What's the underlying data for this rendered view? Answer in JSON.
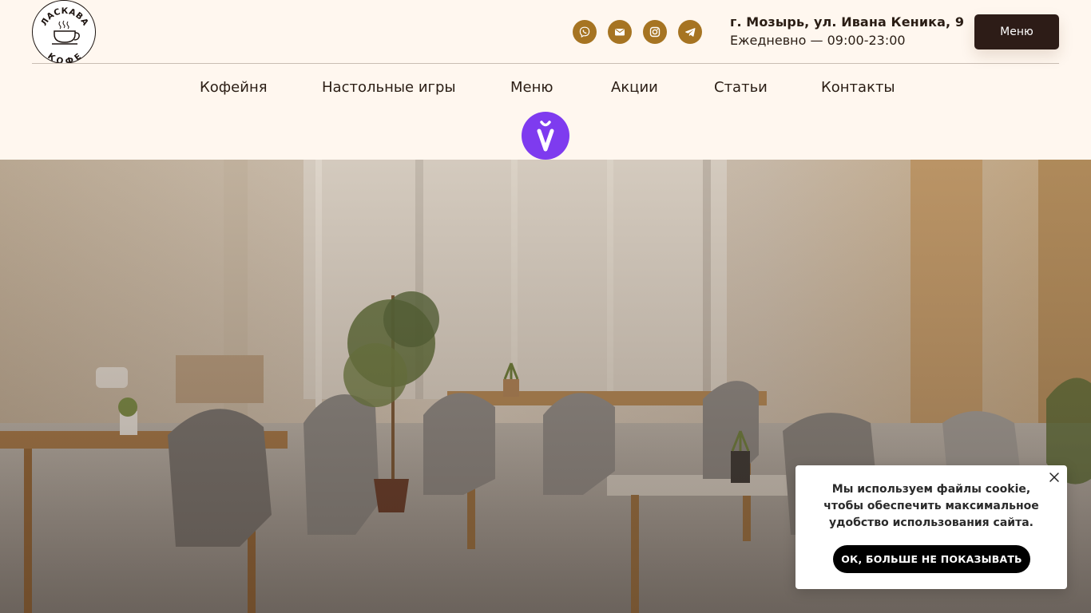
{
  "header": {
    "logo": {
      "icon": "coffee-cup-logo",
      "text_top": "ЛАСКАВА",
      "text_bottom": "КОФЕ"
    },
    "socials": [
      {
        "icon": "phone-viber-icon"
      },
      {
        "icon": "mail-icon"
      },
      {
        "icon": "instagram-icon"
      },
      {
        "icon": "telegram-icon"
      }
    ],
    "address": "г. Мозырь, ул. Ивана Кеника, 9",
    "hours": "Ежедневно — 09:00-23:00",
    "menu_button_label": "Меню"
  },
  "nav": {
    "items": [
      {
        "label": "Кофейня"
      },
      {
        "label": "Настольные игры"
      },
      {
        "label": "Меню"
      },
      {
        "label": "Акции"
      },
      {
        "label": "Статьи"
      },
      {
        "label": "Контакты"
      }
    ]
  },
  "badge": {
    "icon": "accessibility-badge-icon"
  },
  "hero": {
    "image": "cafe-interior-photo"
  },
  "cookie": {
    "text": "Мы используем файлы cookie, чтобы обеспечить максимальное удобство использования сайта.",
    "button_label": "ОК, БОЛЬШЕ НЕ ПОКАЗЫВАТЬ",
    "close_icon": "close-icon"
  },
  "colors": {
    "background": "#fff7ef",
    "accent_gold": "#a67422",
    "button_dark": "#2d1c17",
    "badge_purple": "#7e3bef",
    "text": "#2a1d14"
  }
}
